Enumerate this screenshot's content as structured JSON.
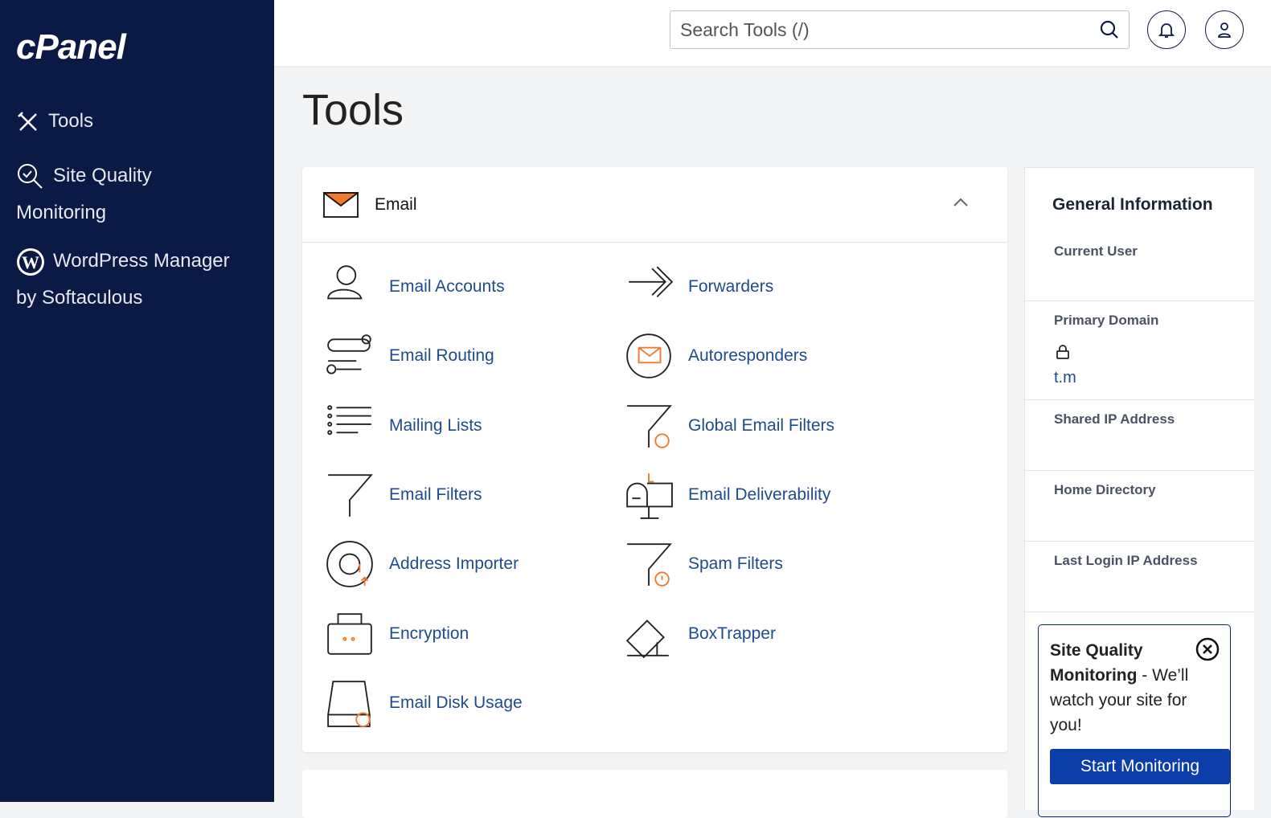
{
  "sidebar": {
    "logo": "cPanel",
    "items": [
      {
        "label": "Tools",
        "icon": "tools-icon"
      },
      {
        "label": "Site Quality",
        "label2": "Monitoring",
        "icon": "site-quality-icon"
      },
      {
        "label": "WordPress Manager",
        "label2": "by Softaculous",
        "icon": "wordpress-icon"
      }
    ]
  },
  "topbar": {
    "search_placeholder": "Search Tools (/)"
  },
  "page": {
    "title": "Tools"
  },
  "email_section": {
    "title": "Email",
    "tools": [
      {
        "label": "Email Accounts",
        "icon": "user-mail"
      },
      {
        "label": "Forwarders",
        "icon": "forward"
      },
      {
        "label": "Email Routing",
        "icon": "routing"
      },
      {
        "label": "Autoresponders",
        "icon": "autoresponder"
      },
      {
        "label": "Mailing Lists",
        "icon": "list"
      },
      {
        "label": "Global Email Filters",
        "icon": "filter-globe"
      },
      {
        "label": "Email Filters",
        "icon": "filter"
      },
      {
        "label": "Email Deliverability",
        "icon": "mailbox"
      },
      {
        "label": "Address Importer",
        "icon": "at"
      },
      {
        "label": "Spam Filters",
        "icon": "filter-alert"
      },
      {
        "label": "Encryption",
        "icon": "encryption"
      },
      {
        "label": "BoxTrapper",
        "icon": "boxtrapper"
      },
      {
        "label": "Email Disk Usage",
        "icon": "disk"
      }
    ]
  },
  "general_info": {
    "title": "General Information",
    "current_user_label": "Current User",
    "primary_domain_label": "Primary Domain",
    "primary_domain_value": "t.m",
    "shared_ip_label": "Shared IP Address",
    "home_dir_label": "Home Directory",
    "last_login_label": "Last Login IP Address"
  },
  "promo": {
    "title": "Site Quality Monitoring",
    "text": " - We’ll watch your site for you!",
    "button": "Start Monitoring"
  },
  "colors": {
    "sidebar": "#0b1a45",
    "link": "#1e4a8e",
    "accent": "#f07a2c",
    "button": "#0b3ea8"
  }
}
